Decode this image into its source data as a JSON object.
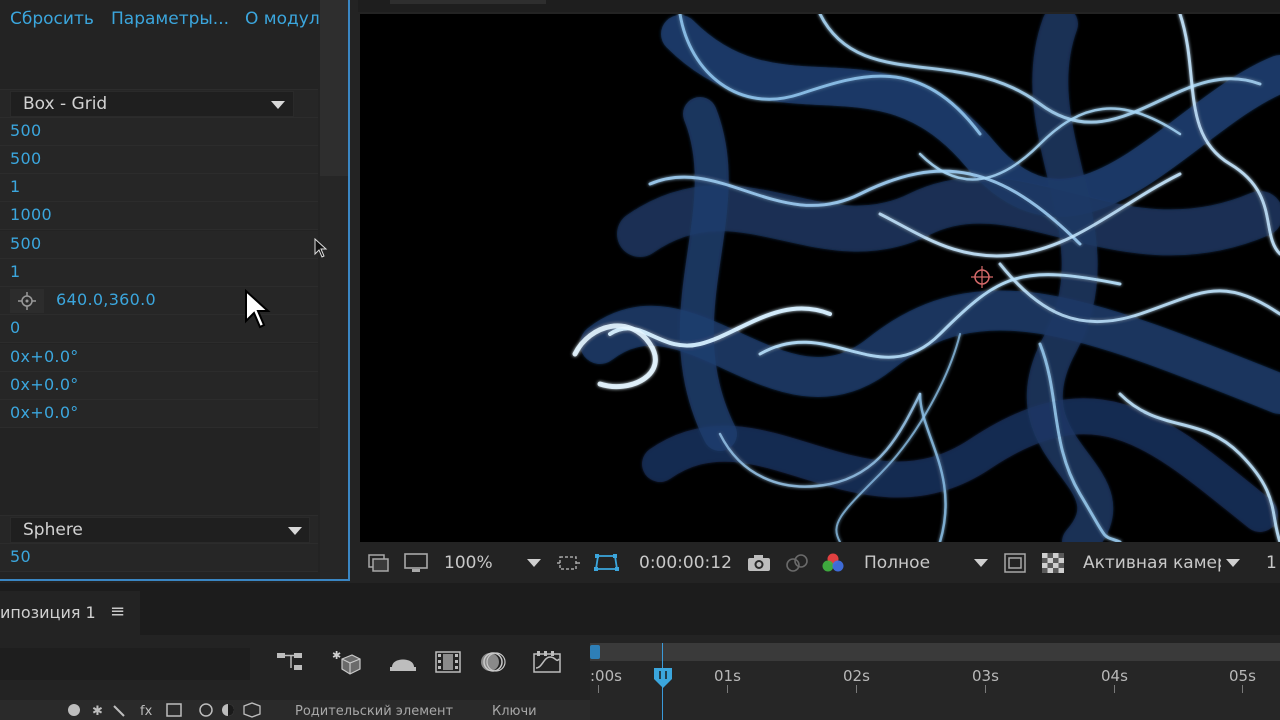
{
  "effect_controls": {
    "header_links": [
      "Сбросить",
      "Параметры...",
      "О модул"
    ],
    "emitter_type": "Box - Grid",
    "values": [
      "500",
      "500",
      "1",
      "1000",
      "500",
      "1"
    ],
    "position": "640.0,360.0",
    "value_zero": "0",
    "rotations": [
      "0x+0.0°",
      "0x+0.0°",
      "0x+0.0°"
    ],
    "particle_type": "Sphere",
    "size_value": "50",
    "icons": [
      "target-icon",
      "dropdown-arrow-icon",
      "mouse-cursor-icon"
    ]
  },
  "viewer": {
    "zoom": "100%",
    "timecode": "0:00:00:12",
    "resolution": "Полное",
    "camera": "Активная камер",
    "views": "1",
    "icons": [
      "snapshot-icon",
      "monitor-icon",
      "region-of-interest-icon",
      "mask-path-icon",
      "camera-icon",
      "show-channel-icon",
      "color-channels-icon",
      "fast-preview-icon",
      "transparency-grid-icon"
    ]
  },
  "timeline": {
    "tab_label": "ипозиция 1",
    "menu_glyph": "≡",
    "ruler_labels": [
      ":00s",
      "01s",
      "02s",
      "03s",
      "04s",
      "05s"
    ],
    "column_headers": [
      "Родительский элемент",
      "Ключи"
    ],
    "icons": [
      "composition-flowchart-icon",
      "draft-3d-icon",
      "shy-layers-icon",
      "frame-blending-icon",
      "motion-blur-icon",
      "graph-editor-icon"
    ]
  },
  "colors": {
    "accent": "#3ba6dd",
    "panel_bg": "#232323",
    "selection_border": "#3a86c3"
  }
}
